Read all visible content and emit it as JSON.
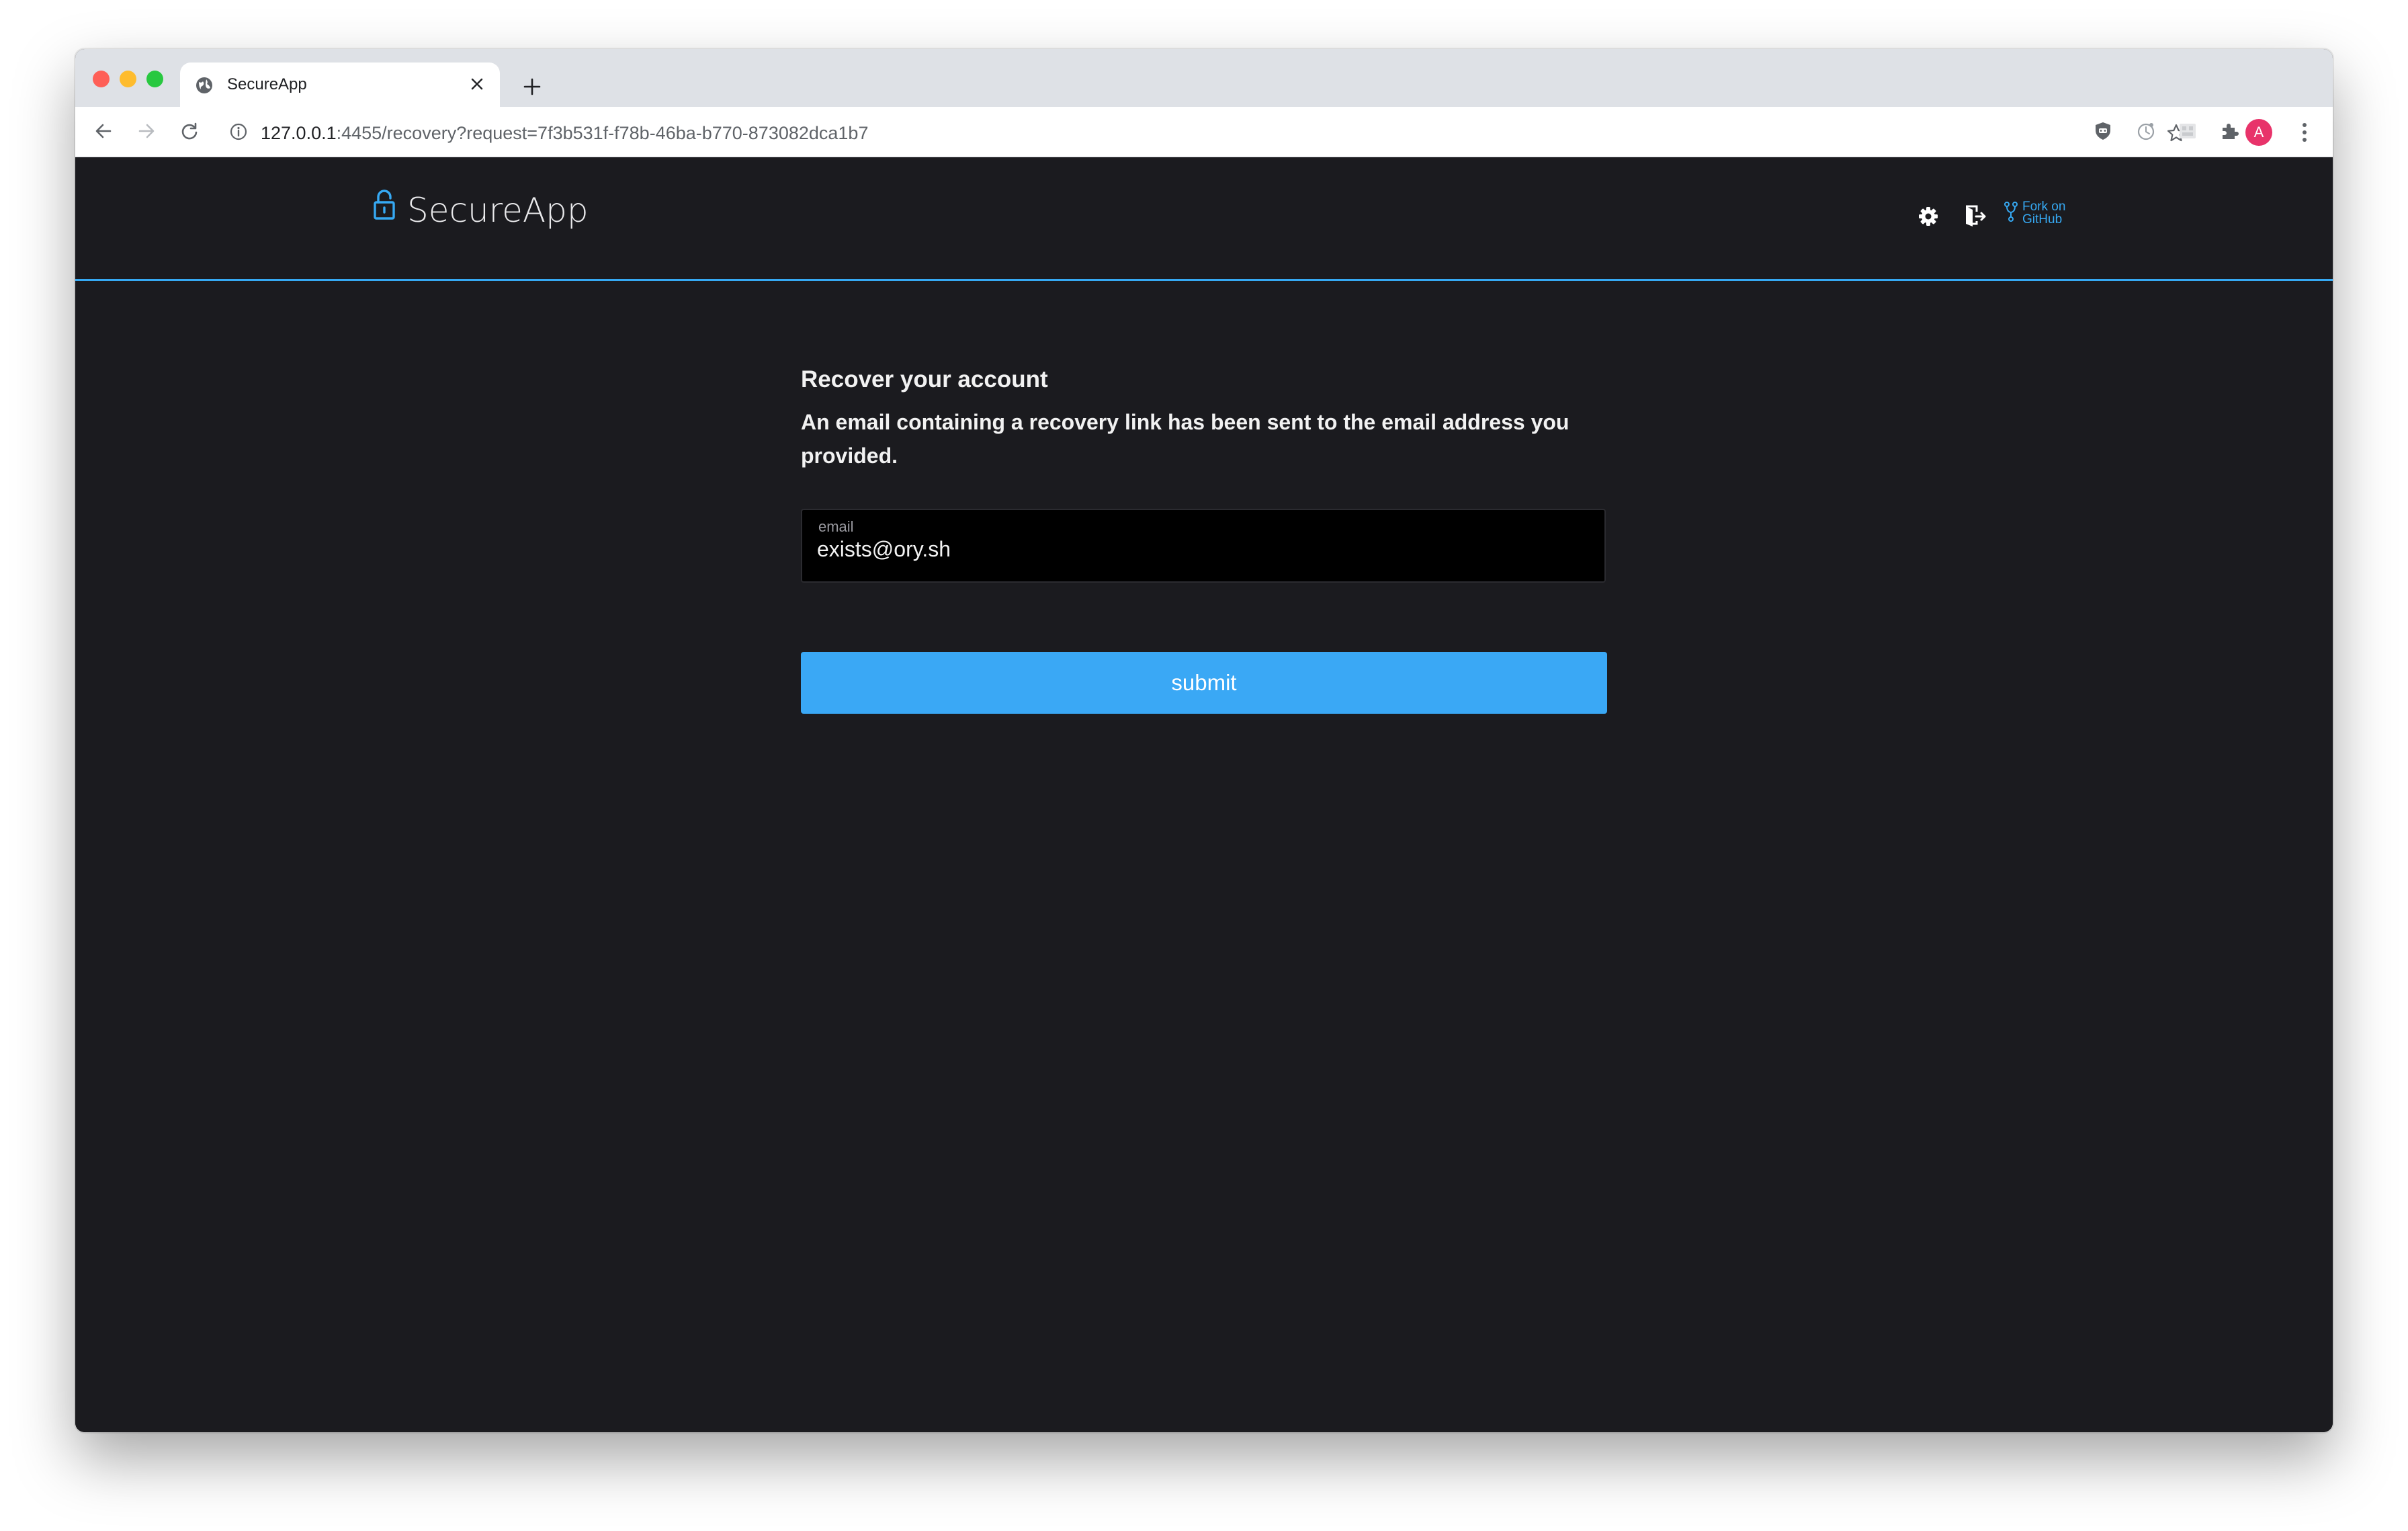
{
  "browser": {
    "tab_title": "SecureApp",
    "url_host": "127.0.0.1",
    "url_rest": ":4455/recovery?request=7f3b531f-f78b-46ba-b770-873082dca1b7",
    "profile_initial": "A"
  },
  "header": {
    "brand": "SecureApp",
    "fork_line1": "Fork on",
    "fork_line2": "GitHub"
  },
  "recovery": {
    "heading": "Recover your account",
    "message": "An email containing a recovery link has been sent to the email address you provided.",
    "email_label": "email",
    "email_value": "exists@ory.sh",
    "submit_label": "submit"
  },
  "colors": {
    "accent": "#36a9f3",
    "page_background": "#1b1b1f",
    "button": "#3aa8f5"
  },
  "icons": [
    "globe-icon",
    "close-icon",
    "plus-icon",
    "back-arrow-icon",
    "forward-arrow-icon",
    "reload-icon",
    "info-icon",
    "star-icon",
    "shield-extension-icon",
    "extension-icon",
    "puzzle-icon",
    "kebab-menu-icon",
    "lock-icon",
    "gear-icon",
    "logout-icon",
    "fork-icon"
  ]
}
